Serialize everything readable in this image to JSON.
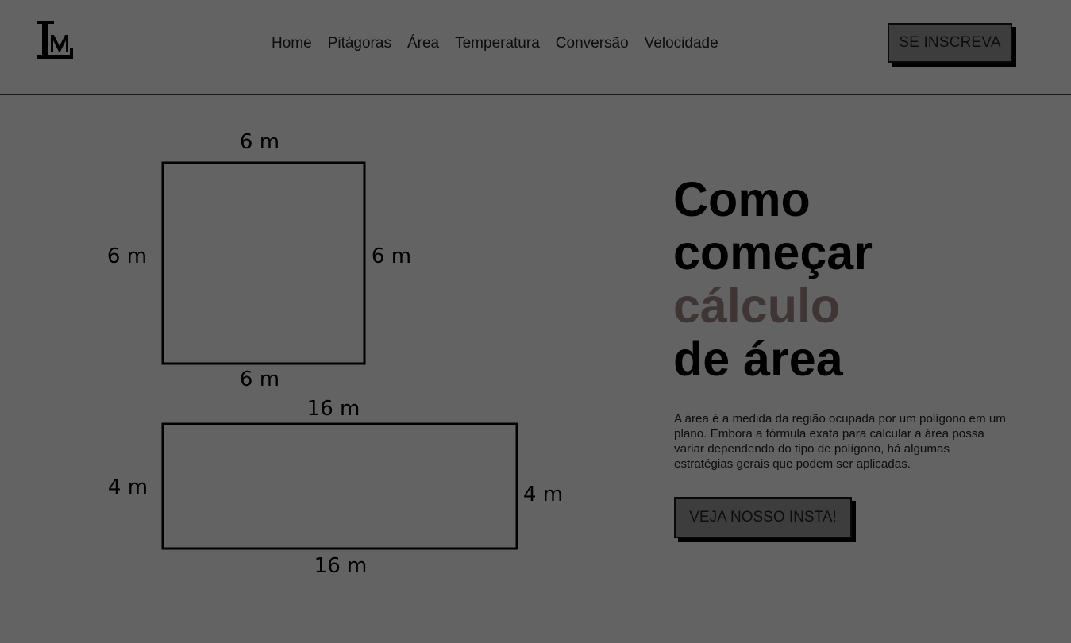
{
  "header": {
    "logo_text": "LM",
    "nav": [
      {
        "label": "Home"
      },
      {
        "label": "Pitágoras"
      },
      {
        "label": "Área"
      },
      {
        "label": "Temperatura"
      },
      {
        "label": "Conversão"
      },
      {
        "label": "Velocidade"
      }
    ],
    "subscribe_label": "SE INSCREVA"
  },
  "diagram": {
    "square": {
      "top": "6 m",
      "left": "6 m",
      "right": "6 m",
      "bottom": "6 m"
    },
    "rectangle": {
      "top": "16 m",
      "left": "4 m",
      "right": "4 m",
      "bottom": "16 m"
    }
  },
  "hero": {
    "title_line1": "Como",
    "title_line2": "começar",
    "title_line3": "cálculo",
    "title_line4": "de área",
    "accent_color": "#3f3535",
    "description": "A área é a medida da região ocupada por um polígono em um plano. Embora a fórmula exata para calcular a área possa variar dependendo do tipo de polígono, há algumas estratégias gerais que podem ser aplicadas.",
    "cta_label": "VEJA NOSSO INSTA!"
  },
  "colors": {
    "background": "#636363",
    "button_bg": "#3d3d3d"
  }
}
